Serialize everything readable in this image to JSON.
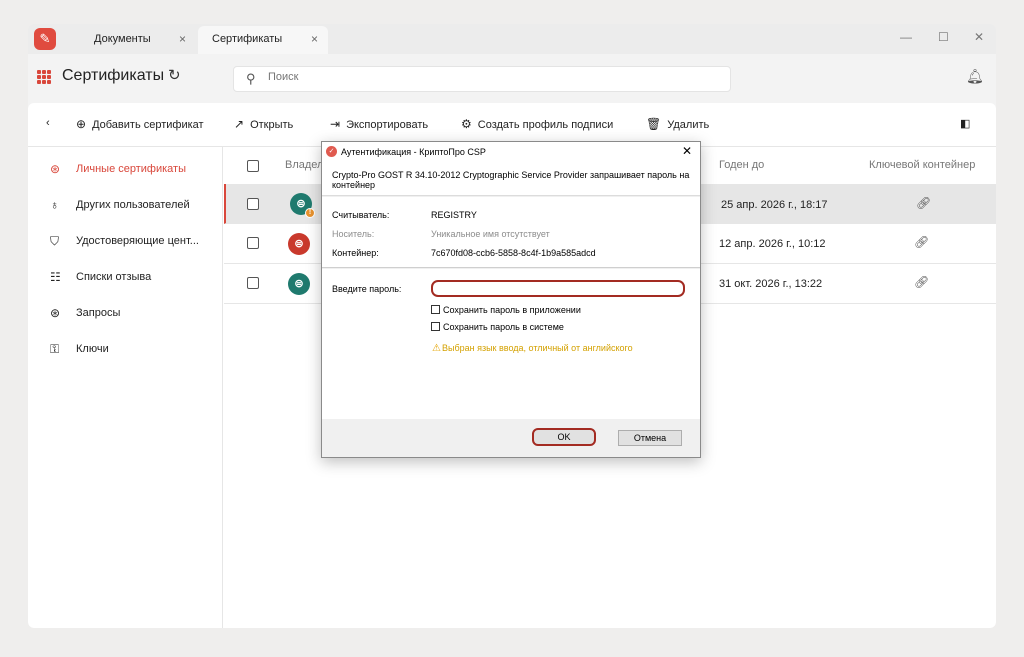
{
  "tabs": [
    {
      "label": "Документы",
      "close": "×"
    },
    {
      "label": "Сертификаты",
      "close": "×"
    }
  ],
  "window_controls": {
    "minimize": "—",
    "maximize": "☐",
    "close": "✕"
  },
  "header": {
    "title": "Сертификаты",
    "search_placeholder": "Поиск"
  },
  "toolbar": {
    "back": "‹",
    "add_certificate": "Добавить сертификат",
    "open": "Открыть",
    "export": "Экспортировать",
    "create_profile": "Создать профиль подписи",
    "delete": "Удалить"
  },
  "sidebar": {
    "items": [
      {
        "label": "Личные сертификаты",
        "icon": "certificate-badge-icon",
        "active": true
      },
      {
        "label": "Других пользователей",
        "icon": "certificate-icon"
      },
      {
        "label": "Удостоверяющие цент...",
        "icon": "shield-icon"
      },
      {
        "label": "Списки отзыва",
        "icon": "revocation-list-icon"
      },
      {
        "label": "Запросы",
        "icon": "request-icon"
      },
      {
        "label": "Ключи",
        "icon": "key-icon"
      }
    ]
  },
  "table": {
    "columns": {
      "owner": "Владел",
      "valid_until": "Годен до",
      "key_container": "Ключевой контейнер"
    },
    "rows": [
      {
        "avatar_color": "#1f7a6e",
        "valid_until": "25 апр. 2026 г., 18:17",
        "selected": true,
        "badge": true
      },
      {
        "avatar_color": "#c9392c",
        "valid_until": "12 апр. 2026 г., 10:12",
        "selected": false,
        "badge": false
      },
      {
        "avatar_color": "#1f7a6e",
        "valid_until": "31 окт. 2026 г., 13:22",
        "selected": false,
        "badge": false
      }
    ]
  },
  "dialog": {
    "title": "Аутентификация - КриптоПро CSP",
    "message": "Crypto-Pro GOST R 34.10-2012 Cryptographic Service Provider запрашивает пароль на контейнер",
    "reader_label": "Считыватель:",
    "reader_value": "REGISTRY",
    "carrier_label": "Носитель:",
    "carrier_value": "Уникальное имя отсутствует",
    "container_label": "Контейнер:",
    "container_value": "7c670fd08-ccb6-5858-8c4f-1b9a585adcd",
    "password_label": "Введите пароль:",
    "password_value": "",
    "save_in_app": "Сохранить пароль в приложении",
    "save_in_system": "Сохранить пароль в системе",
    "warning": "Выбран язык ввода, отличный от английского",
    "ok": "OK",
    "cancel": "Отмена"
  },
  "colors": {
    "accent": "#d9473b",
    "highlight_outline": "#a32b22",
    "warning": "#d4a100"
  }
}
